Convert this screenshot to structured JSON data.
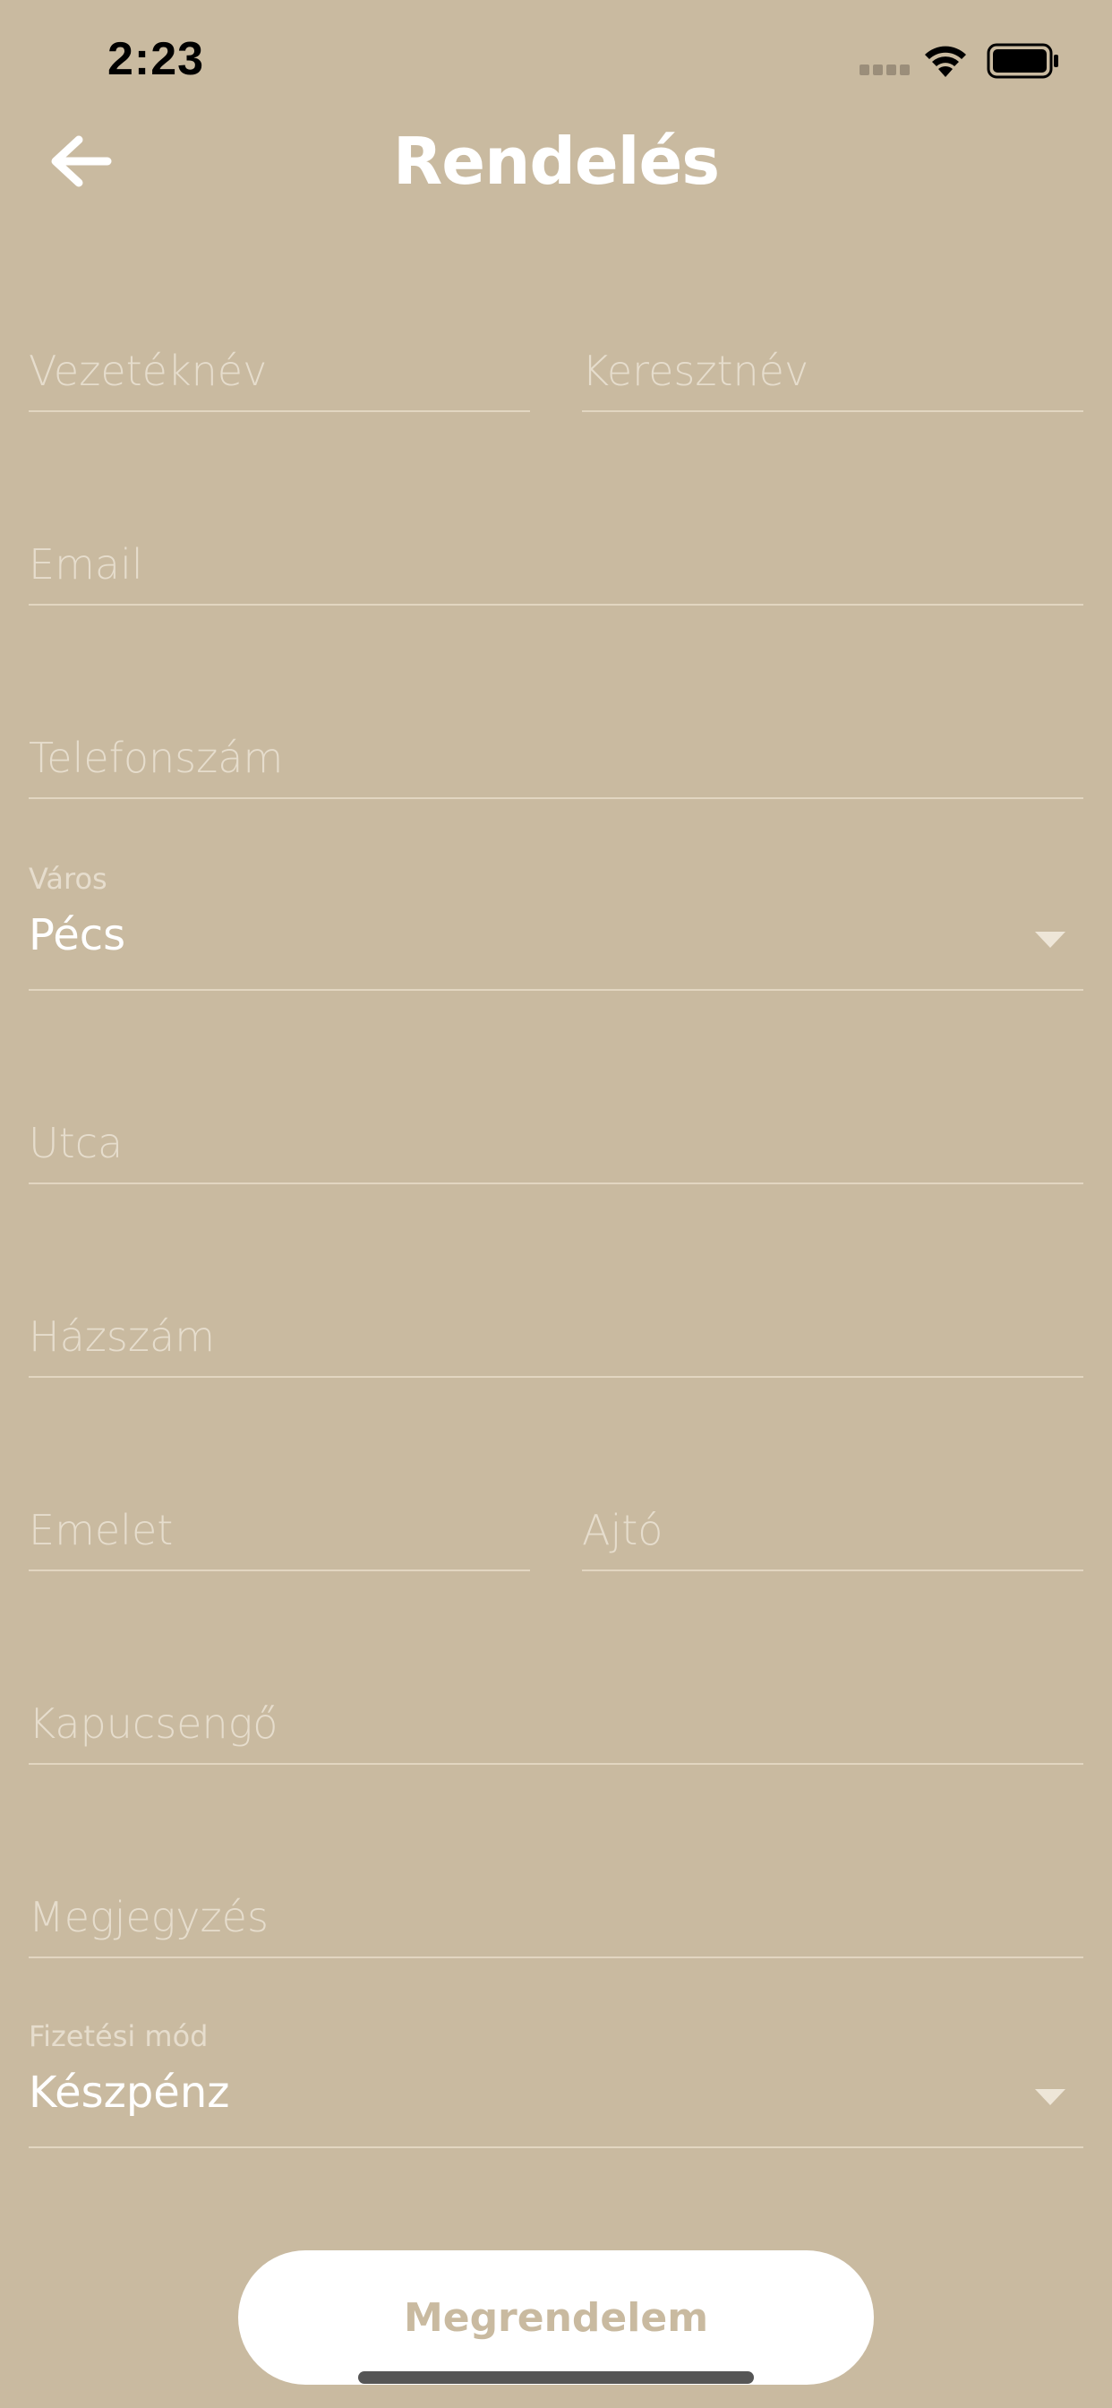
{
  "status_bar": {
    "time": "2:23"
  },
  "header": {
    "title": "Rendelés"
  },
  "form": {
    "last_name_placeholder": "Vezetéknév",
    "first_name_placeholder": "Keresztnév",
    "email_placeholder": "Email",
    "phone_placeholder": "Telefonszám",
    "city": {
      "label": "Város",
      "value": "Pécs"
    },
    "street_placeholder": "Utca",
    "house_number_placeholder": "Házszám",
    "floor_placeholder": "Emelet",
    "door_placeholder": "Ajtó",
    "doorbell_placeholder": "Kapucsengő",
    "note_placeholder": "Megjegyzés",
    "payment": {
      "label": "Fizetési mód",
      "value": "Készpénz"
    },
    "submit_label": "Megrendelem"
  },
  "colors": {
    "background": "#c9baa0",
    "accent_text": "#ffffff",
    "button_background": "#ffffff"
  }
}
